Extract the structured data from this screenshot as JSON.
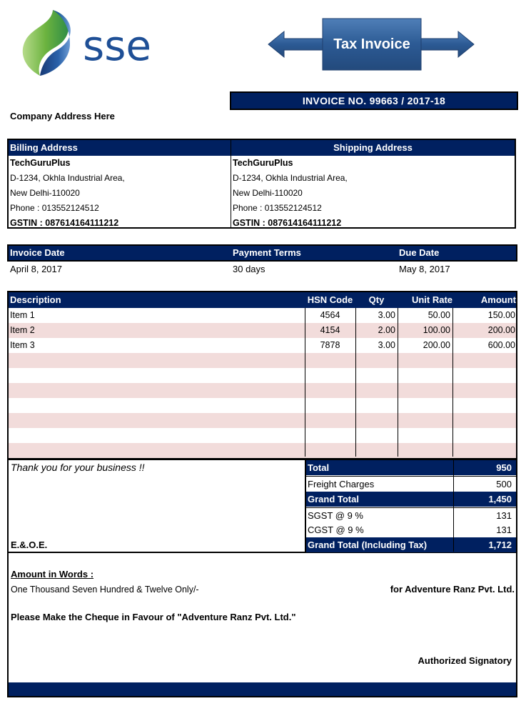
{
  "logo": {
    "text": "sse",
    "icon": "sse-swirl-logo"
  },
  "banner": {
    "title": "Tax Invoice",
    "icon": "double-arrow-banner"
  },
  "invoice_number": "INVOICE NO. 99663 / 2017-18",
  "company_address": "Company Address Here",
  "billing": {
    "header": "Billing Address",
    "name": "TechGuruPlus",
    "address1": "D-1234, Okhla Industrial Area,",
    "address2": "New Delhi-110020",
    "phone": "Phone : 013552124512",
    "gstin": "GSTIN : 087614164111212"
  },
  "shipping": {
    "header": "Shipping Address",
    "name": "TechGuruPlus",
    "address1": "D-1234, Okhla Industrial Area,",
    "address2": "New Delhi-110020",
    "phone": "Phone : 013552124512",
    "gstin": "GSTIN : 087614164111212"
  },
  "dates": {
    "headers": {
      "invoice_date": "Invoice Date",
      "payment_terms": "Payment Terms",
      "due_date": "Due Date"
    },
    "values": {
      "invoice_date": "April 8, 2017",
      "payment_terms": "30 days",
      "due_date": "May 8, 2017"
    }
  },
  "items": {
    "columns": [
      "Description",
      "HSN Code",
      "Qty",
      "Unit Rate",
      "Amount"
    ],
    "rows": [
      [
        "Item 1",
        "4564",
        "3.00",
        "50.00",
        "150.00"
      ],
      [
        "Item 2",
        "4154",
        "2.00",
        "100.00",
        "200.00"
      ],
      [
        "Item 3",
        "7878",
        "3.00",
        "200.00",
        "600.00"
      ],
      [
        "",
        "",
        "",
        "",
        ""
      ],
      [
        "",
        "",
        "",
        "",
        ""
      ],
      [
        "",
        "",
        "",
        "",
        ""
      ],
      [
        "",
        "",
        "",
        "",
        ""
      ],
      [
        "",
        "",
        "",
        "",
        ""
      ],
      [
        "",
        "",
        "",
        "",
        ""
      ],
      [
        "",
        "",
        "",
        "",
        ""
      ]
    ]
  },
  "summary": {
    "thanks": "Thank you for your business !!",
    "eoe": "E.&.O.E.",
    "totals": [
      {
        "label": "Total",
        "value": "950",
        "highlight": true
      },
      {
        "label": "Freight Charges",
        "value": "500",
        "highlight": false
      },
      {
        "label": "Grand Total",
        "value": "1,450",
        "highlight": true
      },
      {
        "label": "SGST @ 9 %",
        "value": "131",
        "highlight": false
      },
      {
        "label": "CGST @ 9 %",
        "value": "131",
        "highlight": false
      },
      {
        "label": "Grand Total (Including Tax)",
        "value": "1,712",
        "highlight": true
      }
    ]
  },
  "footer": {
    "amount_in_words_label": "Amount in Words :",
    "amount_in_words": "One Thousand Seven Hundred & Twelve Only/-",
    "for_company": "for Adventure Ranz Pvt. Ltd.",
    "cheque_note": "Please Make the Cheque in Favour of \"Adventure Ranz Pvt. Ltd.\"",
    "signatory": "Authorized Signatory"
  },
  "colors": {
    "header_navy": "#002060",
    "row_alt": "#f2dcdb",
    "logo_blue": "#1e4f96",
    "logo_green": "#7cc242"
  }
}
